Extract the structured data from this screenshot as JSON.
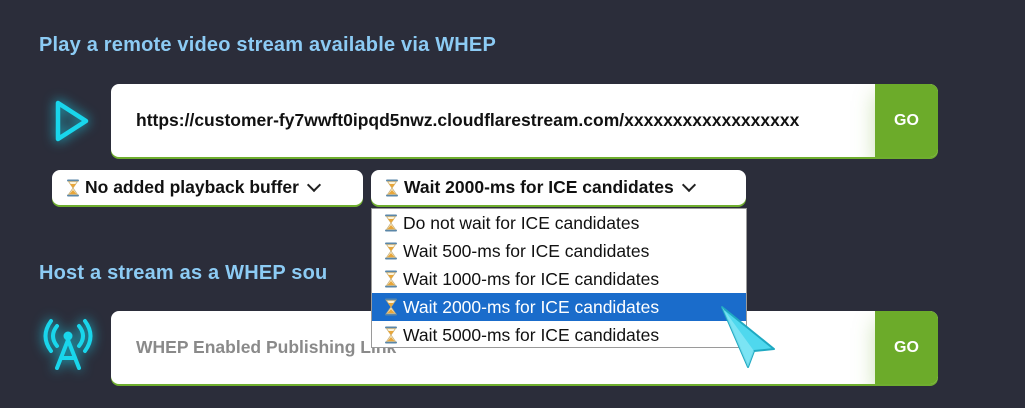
{
  "sections": {
    "play_heading": "Play a remote video stream available via WHEP",
    "host_heading": "Host a stream as a WHEP sou"
  },
  "play": {
    "url_value": "https://customer-fy7wwft0ipqd5nwz.cloudflarestream.com/xxxxxxxxxxxxxxxxxx",
    "go_label": "GO"
  },
  "host": {
    "placeholder": "WHEP Enabled Publishing Link",
    "go_label": "GO"
  },
  "selects": {
    "buffer_value": "No added playback buffer",
    "ice_value": "Wait 2000-ms for ICE candidates"
  },
  "dropdown": {
    "options": [
      "Do not wait for ICE candidates",
      "Wait 500-ms for ICE candidates",
      "Wait 1000-ms for ICE candidates",
      "Wait 2000-ms for ICE candidates",
      "Wait 5000-ms for ICE candidates"
    ],
    "selected_index": 3
  },
  "icons": [
    "play-icon",
    "antenna-icon",
    "hourglass-icon",
    "chevron-down-icon",
    "cursor-icon"
  ],
  "colors": {
    "background": "#2b2d3a",
    "heading": "#8ccbf4",
    "accent_green": "#6cab2a",
    "icon_cyan": "#1ac8e0",
    "selected_option": "#1a6ccb"
  }
}
